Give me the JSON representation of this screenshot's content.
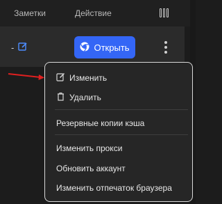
{
  "table": {
    "header": {
      "notes_label": "Заметки",
      "action_label": "Действие",
      "columns_icon": "columns-icon"
    },
    "row": {
      "notes_value": "-",
      "edit_note_icon": "edit-icon",
      "open_button_label": "Открыть",
      "open_button_icon": "chrome-icon",
      "more_icon": "more-vertical-icon"
    }
  },
  "context_menu": {
    "items": [
      {
        "label": "Изменить",
        "icon": "edit-icon"
      },
      {
        "label": "Удалить",
        "icon": "trash-icon"
      },
      {
        "label": "Резервные копии кэша"
      },
      {
        "label": "Изменить прокси"
      },
      {
        "label": "Обновить аккаунт"
      },
      {
        "label": "Изменить отпечаток браузера"
      }
    ]
  },
  "annotation": {
    "arrow_color": "#e02020"
  },
  "colors": {
    "accent": "#3466f6",
    "background": "#1c1c1c",
    "menu_border": "#d9d9d9"
  }
}
